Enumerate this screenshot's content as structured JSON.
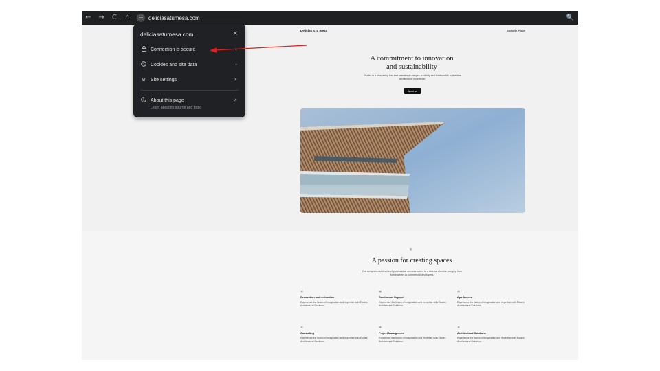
{
  "browser": {
    "url": "deliciasatumesa.com",
    "back_icon": "←",
    "forward_icon": "→",
    "reload_icon": "C",
    "home_icon": "⌂",
    "site_icon": "☷",
    "zoom_icon": "🔍"
  },
  "site_info_popup": {
    "title": "deliciasatumesa.com",
    "close": "×",
    "items": [
      {
        "label": "Connection is secure",
        "icon": "lock-icon",
        "trail": "›"
      },
      {
        "label": "Cookies and site data",
        "icon": "cookie-icon",
        "trail": "›"
      },
      {
        "label": "Site settings",
        "icon": "gear-icon",
        "trail": "↗"
      }
    ],
    "about": {
      "label": "About this page",
      "sub": "Learn about its source and topic",
      "trail": "↗"
    }
  },
  "webpage": {
    "nav": {
      "brand": "Delicias a tu mesa",
      "link": "Sample Page"
    },
    "hero": {
      "title_line1": "A commitment to innovation",
      "title_line2": "and sustainability",
      "subtitle": "Études is a pioneering firm that seamlessly merges creativity and functionality to redefine architectural excellence.",
      "button": "About us"
    },
    "services": {
      "title": "A passion for creating spaces",
      "subtitle": "Our comprehensive suite of professional services caters to a diverse clientele, ranging from homeowners to commercial developers.",
      "items": [
        {
          "title": "Renovation and restoration",
          "desc": "Experience the fusion of imagination and expertise with Études Architectural Solutions."
        },
        {
          "title": "Continuous Support",
          "desc": "Experience the fusion of imagination and expertise with Études Architectural Solutions."
        },
        {
          "title": "App Access",
          "desc": "Experience the fusion of imagination and expertise with Études Architectural Solutions."
        },
        {
          "title": "Consulting",
          "desc": "Experience the fusion of imagination and expertise with Études Architectural Solutions."
        },
        {
          "title": "Project Management",
          "desc": "Experience the fusion of imagination and expertise with Études Architectural Solutions."
        },
        {
          "title": "Architectural Solutions",
          "desc": "Experience the fusion of imagination and expertise with Études Architectural Solutions."
        }
      ]
    }
  },
  "colors": {
    "annotation_arrow": "#e0201c",
    "popup_bg": "#202124",
    "toolbar_bg": "#1f2021"
  }
}
